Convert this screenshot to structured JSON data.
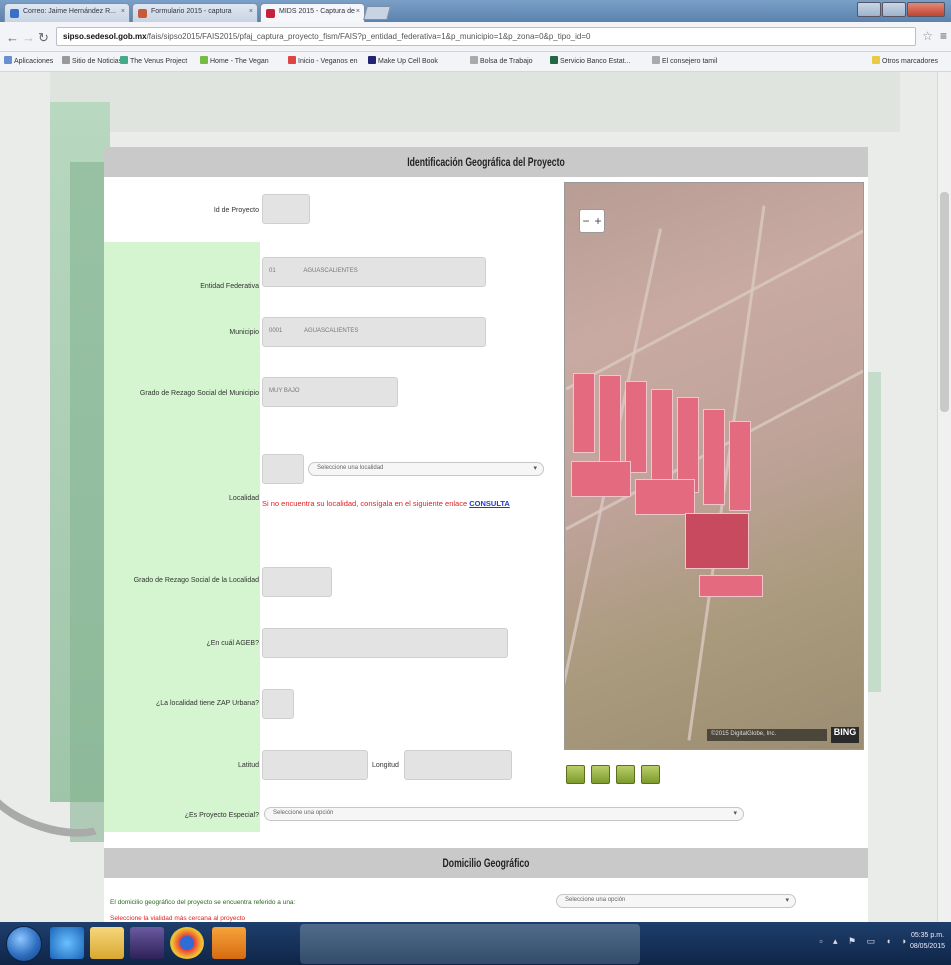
{
  "browser": {
    "tabs": [
      {
        "title": "Correo: Jaime Hernández R...",
        "active": false
      },
      {
        "title": "Formulario 2015 - captura",
        "active": false
      },
      {
        "title": "MIDS 2015 - Captura de",
        "active": true
      }
    ],
    "url_host": "sipso.sedesol.gob.mx",
    "url_rest": "/fais/sipso2015/FAIS2015/pfaj_captura_proyecto_fism/FAIS?p_entidad_federativa=1&p_municipio=1&p_zona=0&p_tipo_id=0",
    "bookmarks": [
      "Aplicaciones",
      "Sitio de Noticias",
      "The Venus Project",
      "Home - The Vegan",
      "Inicio - Veganos en",
      "Make Up Cell Book",
      "Bolsa de Trabajo",
      "Servicio Banco Estat...",
      "El consejero tamil"
    ],
    "bookmarks_right": "Otros marcadores"
  },
  "section1": {
    "title": "Identificación Geográfica del Proyecto",
    "labels": {
      "folio": "Id de Proyecto",
      "entidad": "Entidad Federativa",
      "municipio": "Municipio",
      "grado_mun": "Grado de Rezago Social del Municipio",
      "localidad": "Localidad",
      "grado_loc": "Grado de Rezago Social de la Localidad",
      "ageb": "¿En cuál AGEB?",
      "zap": "¿La localidad tiene ZAP Urbana?",
      "latitud": "Latitud",
      "longitud": "Longitud",
      "especial": "¿Es Proyecto Especial?"
    },
    "values": {
      "entidad_code": "01",
      "entidad_name": "AGUASCALIENTES",
      "municipio_code": "0001",
      "municipio_name": "AGUASCALIENTES",
      "grado_mun": "MUY BAJO"
    },
    "localidad_select": "Seleccione una localidad",
    "localidad_warning": "Si no encuentra su localidad, consígala en el siguiente enlace",
    "localidad_link": "CONSULTA",
    "especial_select": "Seleccione una opción"
  },
  "map": {
    "zoom_in": "+",
    "zoom_out": "−",
    "attribution": "©2015 DigitalGlobe, Inc.",
    "logo": "BING"
  },
  "section2": {
    "title": "Domicilio Geográfico",
    "text": "El domicilio geográfico del proyecto se encuentra referido a una:",
    "select": "Seleccione una opción",
    "warning": "Seleccione la vialidad más cercana al proyecto"
  },
  "taskbar": {
    "clock_time": "05:35 p.m.",
    "clock_date": "08/05/2015"
  }
}
